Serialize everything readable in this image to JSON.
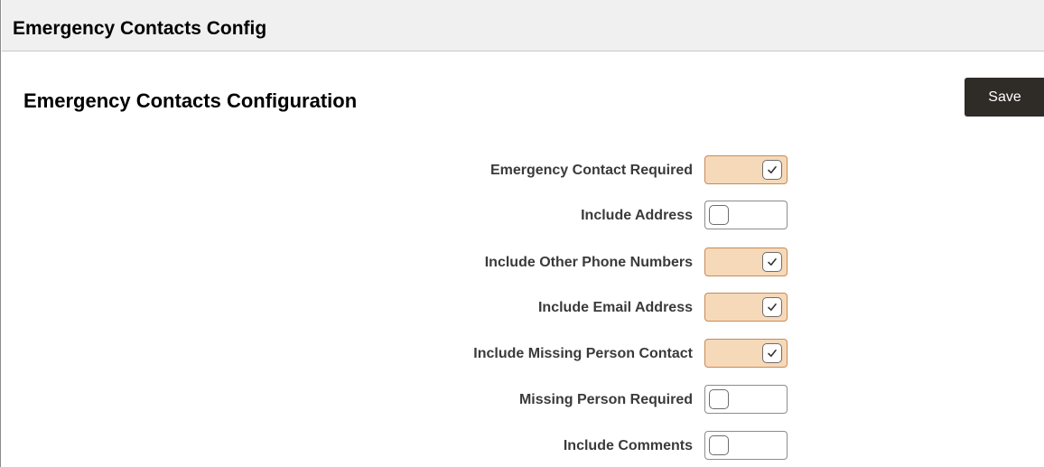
{
  "header": {
    "title": "Emergency Contacts Config"
  },
  "main": {
    "heading": "Emergency Contacts Configuration",
    "save_label": "Save",
    "fields": [
      {
        "label": "Emergency Contact Required",
        "checked": true
      },
      {
        "label": "Include Address",
        "checked": false
      },
      {
        "label": "Include Other Phone Numbers",
        "checked": true
      },
      {
        "label": "Include Email Address",
        "checked": true
      },
      {
        "label": "Include Missing Person Contact",
        "checked": true
      },
      {
        "label": "Missing Person Required",
        "checked": false
      },
      {
        "label": "Include Comments",
        "checked": false
      }
    ]
  },
  "colors": {
    "title_bar_bg": "#f0f0f0",
    "save_button_bg": "#2f2b27",
    "toggle_on_bg": "#f6d9b9",
    "toggle_on_border": "#c98a55",
    "toggle_off_border": "#8c8c8c"
  },
  "icons": {
    "checked": "checkmark-icon",
    "unchecked": "empty-checkbox-icon"
  }
}
